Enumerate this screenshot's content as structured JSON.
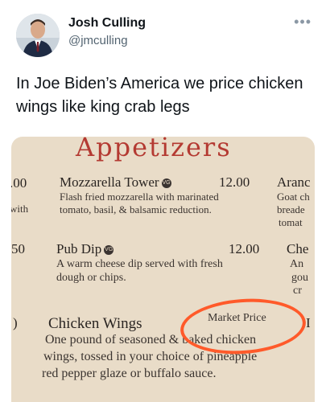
{
  "author": {
    "name": "Josh Culling",
    "handle": "@jmculling",
    "more_icon": "more-horizontal-icon"
  },
  "tweet": {
    "text": "In Joe Biden’s America we price chicken wings like king crab legs"
  },
  "menu": {
    "title": "Appetizers",
    "left_fragments": [
      ".00",
      "with",
      "50",
      ")"
    ],
    "items": [
      {
        "name": "Mozzarella Tower",
        "badge": "VG",
        "price": "12.00",
        "desc1": "Flash fried mozzarella with marinated",
        "desc2": "tomato, basil, & balsamic reduction."
      },
      {
        "name": "Pub Dip",
        "badge": "VG",
        "price": "12.00",
        "desc1": "A warm cheese dip served with fresh",
        "desc2": "dough or chips."
      },
      {
        "name": "Chicken Wings",
        "price": "Market Price",
        "desc1": "One pound of seasoned & baked chicken",
        "desc2": "wings, tossed in your choice of pineapple",
        "desc3": "red pepper glaze or buffalo sauce."
      }
    ],
    "right_fragments": [
      "Aranc",
      "Goat ch",
      "breade",
      "tomat",
      "Che",
      "An",
      "gou",
      "cr",
      "I"
    ]
  }
}
